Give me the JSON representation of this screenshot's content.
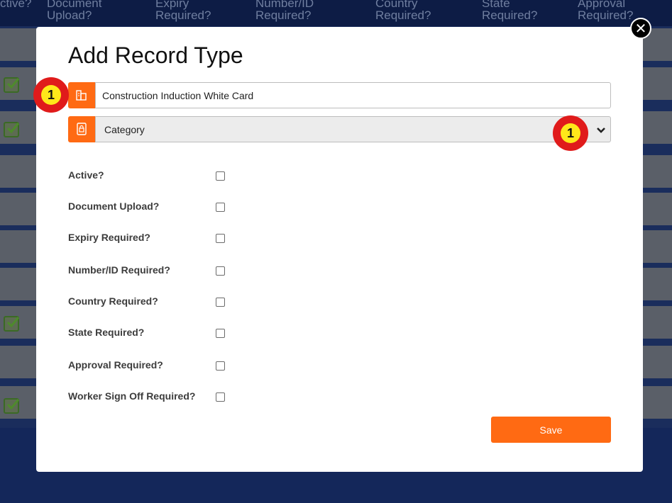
{
  "background_table": {
    "columns": [
      "ctive?",
      "Document\nUpload?",
      "Expiry\nRequired?",
      "Number/ID\nRequired?",
      "Country\nRequired?",
      "State\nRequired?",
      "Approval\nRequired?"
    ]
  },
  "modal": {
    "title": "Add Record Type",
    "close_label": "✕",
    "name_input": {
      "value": "Construction Induction White Card",
      "icon": "building-icon"
    },
    "category_select": {
      "value": "Category",
      "icon": "lock-document-icon"
    },
    "checkboxes": [
      {
        "label": "Active?",
        "checked": false
      },
      {
        "label": "Document Upload?",
        "checked": false
      },
      {
        "label": "Expiry Required?",
        "checked": false
      },
      {
        "label": "Number/ID Required?",
        "checked": false
      },
      {
        "label": "Country Required?",
        "checked": false
      },
      {
        "label": "State Required?",
        "checked": false
      },
      {
        "label": "Approval Required?",
        "checked": false
      },
      {
        "label": "Worker Sign Off Required?",
        "checked": false
      }
    ],
    "save_label": "Save"
  },
  "annotations": {
    "badge_1": "1",
    "badge_2": "1"
  },
  "colors": {
    "accent": "#ff6a13",
    "badge": "#e01b1b",
    "badge_inner": "#ffe81a"
  }
}
